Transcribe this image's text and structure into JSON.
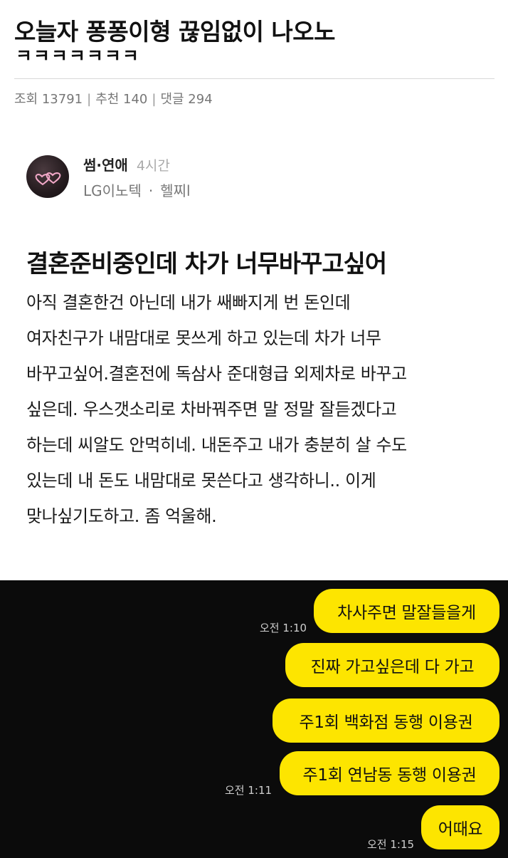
{
  "post": {
    "title_line1": "오늘자 퐁퐁이형 끊임없이 나오노",
    "title_line2": "ㅋㅋㅋㅋㅋㅋㅋ",
    "stats": {
      "views": "조회 13791",
      "recommends": "추천 140",
      "comments": "댓글 294",
      "separator": "|"
    }
  },
  "screenshot_post": {
    "board": "썸·연애",
    "time": "4시간",
    "company": "LG이노텍",
    "dot": "·",
    "nickname": "헬찌l",
    "title": "결혼준비중인데 차가 너무바꾸고싶어",
    "body_lines": [
      "아직 결혼한건 아닌데 내가 쌔빠지게 번 돈인데",
      "여자친구가 내맘대로 못쓰게 하고 있는데 차가 너무",
      "바꾸고싶어.결혼전에 독삼사 준대형급 외제차로 바꾸고",
      "싶은데. 우스갯소리로 차바꿔주면 말 정말 잘듣겠다고",
      "하는데 씨알도 안먹히네. 내돈주고 내가 충분히 살 수도",
      "있는데 내 돈도 내맘대로 못쓴다고 생각하니.. 이게",
      "맞나싶기도하고. 좀 억울해."
    ]
  },
  "chat": {
    "messages": [
      {
        "text": "차사주면 말잘들을게"
      },
      {
        "text": "진짜 가고싶은데 다 가고"
      },
      {
        "text": "주1회 백화점 동행 이용권"
      },
      {
        "text": "주1회 연남동 동행 이용권"
      },
      {
        "text": "어때요"
      }
    ],
    "timestamps": [
      "오전 1:10",
      "오전 1:11",
      "오전 1:15"
    ],
    "colors": {
      "bubble": "#fde500",
      "background": "#0b0b0b"
    }
  }
}
